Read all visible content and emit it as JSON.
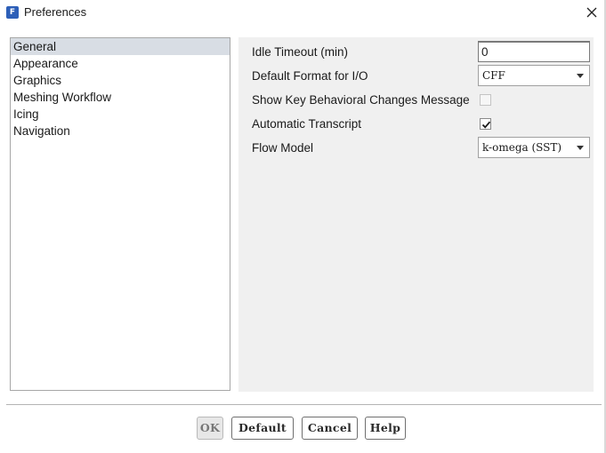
{
  "window": {
    "title": "Preferences",
    "app_icon_glyph": "F",
    "app_icon": "app-logo-icon",
    "close_icon": "close-icon"
  },
  "categories": {
    "selected_index": 0,
    "items": [
      {
        "label": "General"
      },
      {
        "label": "Appearance"
      },
      {
        "label": "Graphics"
      },
      {
        "label": "Meshing Workflow"
      },
      {
        "label": "Icing"
      },
      {
        "label": "Navigation"
      }
    ]
  },
  "settings": {
    "idle_timeout": {
      "label": "Idle Timeout (min)",
      "value": "0"
    },
    "default_format": {
      "label": "Default Format for I/O",
      "value": "CFF"
    },
    "show_key_changes": {
      "label": "Show Key Behavioral Changes Message",
      "checked": false,
      "enabled": false
    },
    "automatic_transcript": {
      "label": "Automatic Transcript",
      "checked": true,
      "enabled": true
    },
    "flow_model": {
      "label": "Flow Model",
      "value": "k-omega (SST)"
    }
  },
  "buttons": {
    "ok": "OK",
    "default": "Default",
    "cancel": "Cancel",
    "help": "Help"
  },
  "colors": {
    "selection": "#d8dde4",
    "panel_bg": "#f0f0f0",
    "app_icon_bg": "#2d5fb8"
  }
}
